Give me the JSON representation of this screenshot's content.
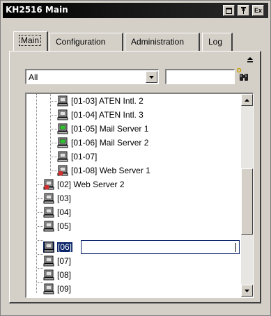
{
  "window": {
    "title": "KH2516 Main",
    "buttons": [
      "minimize",
      "pin",
      "exit"
    ],
    "exit_label": "Ex"
  },
  "tabs": [
    {
      "label": "Main",
      "active": true
    },
    {
      "label": "Configuration",
      "active": false
    },
    {
      "label": "Administration",
      "active": false
    },
    {
      "label": "Log",
      "active": false
    }
  ],
  "filter": {
    "selected": "All",
    "search_value": ""
  },
  "tree": {
    "items": [
      {
        "label": "[01-03]  ATEN Intl. 2",
        "level": 2,
        "icon": "computer-icon"
      },
      {
        "label": "[01-04]  ATEN Intl. 3",
        "level": 2,
        "icon": "computer-icon"
      },
      {
        "label": "[01-05]  Mail Server 1",
        "level": 2,
        "icon": "computer-online-icon"
      },
      {
        "label": "[01-06]  Mail Server 2",
        "level": 2,
        "icon": "computer-online-icon"
      },
      {
        "label": "[01-07]",
        "level": 2,
        "icon": "computer-icon"
      },
      {
        "label": "[01-08]  Web Server 1",
        "level": 2,
        "icon": "computer-warning-icon"
      },
      {
        "label": "[02]  Web Server 2",
        "level": 1,
        "icon": "computer-warning-icon"
      },
      {
        "label": "[03]",
        "level": 1,
        "icon": "computer-icon"
      },
      {
        "label": "[04]",
        "level": 1,
        "icon": "computer-icon"
      },
      {
        "label": "[05]",
        "level": 1,
        "icon": "computer-icon"
      },
      {
        "label": "[06]",
        "level": 1,
        "icon": "computer-icon",
        "selected": true
      },
      {
        "label": "[07]",
        "level": 1,
        "icon": "computer-icon"
      },
      {
        "label": "[08]",
        "level": 1,
        "icon": "computer-icon"
      },
      {
        "label": "[09]",
        "level": 1,
        "icon": "computer-icon"
      }
    ],
    "rename_value": ""
  },
  "colors": {
    "selection": "#0a246a",
    "online": "#2cc52c",
    "warning": "#d03030"
  }
}
